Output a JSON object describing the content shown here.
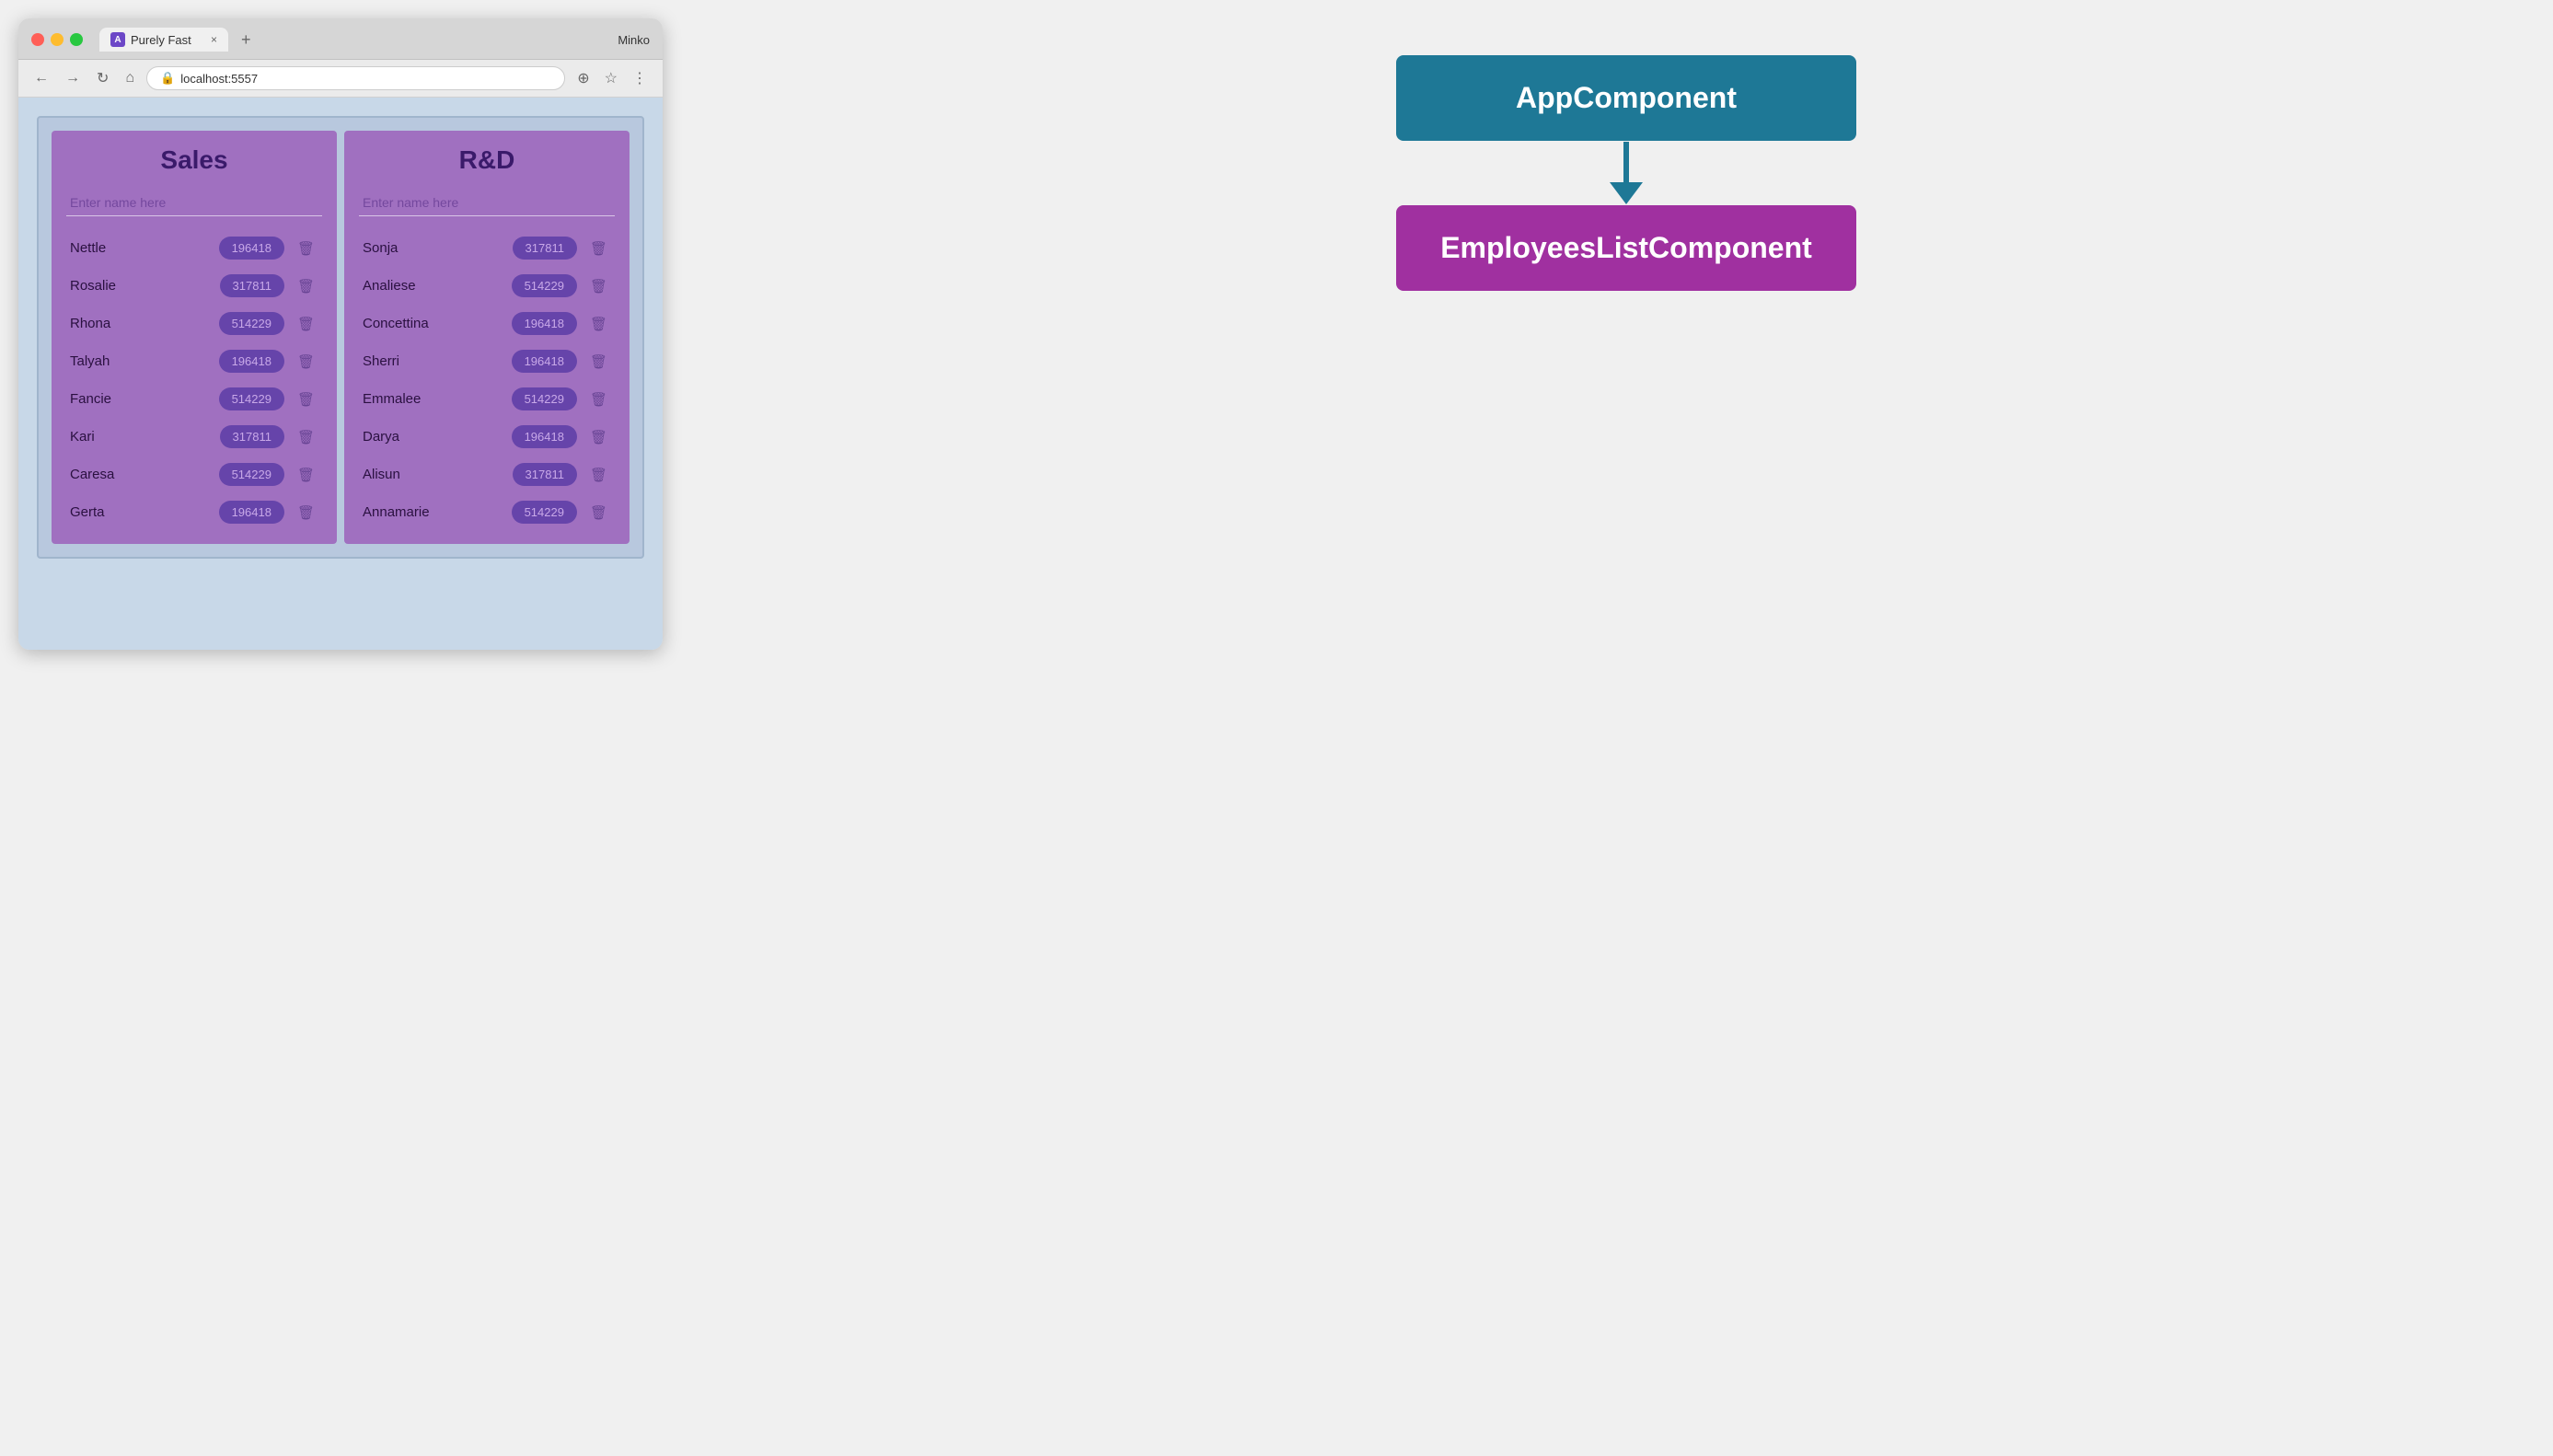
{
  "browser": {
    "traffic_lights": [
      "red",
      "yellow",
      "green"
    ],
    "tab": {
      "favicon_letter": "A",
      "title": "Purely Fast",
      "close_label": "×"
    },
    "user_name": "Minko",
    "new_tab_label": "+",
    "address": "localhost:5557",
    "nav": {
      "back": "←",
      "forward": "→",
      "reload": "↻",
      "home": "⌂"
    },
    "toolbar_icons": {
      "cast": "⊕",
      "star": "☆",
      "menu": "⋮"
    }
  },
  "app": {
    "departments": [
      {
        "id": "sales",
        "title": "Sales",
        "input_placeholder": "Enter name here",
        "employees": [
          {
            "name": "Nettle",
            "salary": "196418"
          },
          {
            "name": "Rosalie",
            "salary": "317811"
          },
          {
            "name": "Rhona",
            "salary": "514229"
          },
          {
            "name": "Talyah",
            "salary": "196418"
          },
          {
            "name": "Fancie",
            "salary": "514229"
          },
          {
            "name": "Kari",
            "salary": "317811"
          },
          {
            "name": "Caresa",
            "salary": "514229"
          },
          {
            "name": "Gerta",
            "salary": "196418"
          }
        ]
      },
      {
        "id": "rnd",
        "title": "R&D",
        "input_placeholder": "Enter name here",
        "employees": [
          {
            "name": "Sonja",
            "salary": "317811"
          },
          {
            "name": "Analiese",
            "salary": "514229"
          },
          {
            "name": "Concettina",
            "salary": "196418"
          },
          {
            "name": "Sherri",
            "salary": "196418"
          },
          {
            "name": "Emmalee",
            "salary": "514229"
          },
          {
            "name": "Darya",
            "salary": "196418"
          },
          {
            "name": "Alisun",
            "salary": "317811"
          },
          {
            "name": "Annamarie",
            "salary": "514229"
          }
        ]
      }
    ]
  },
  "diagram": {
    "app_component_label": "AppComponent",
    "employees_component_label": "EmployeesListComponent",
    "arrow_color": "#1e7896"
  }
}
